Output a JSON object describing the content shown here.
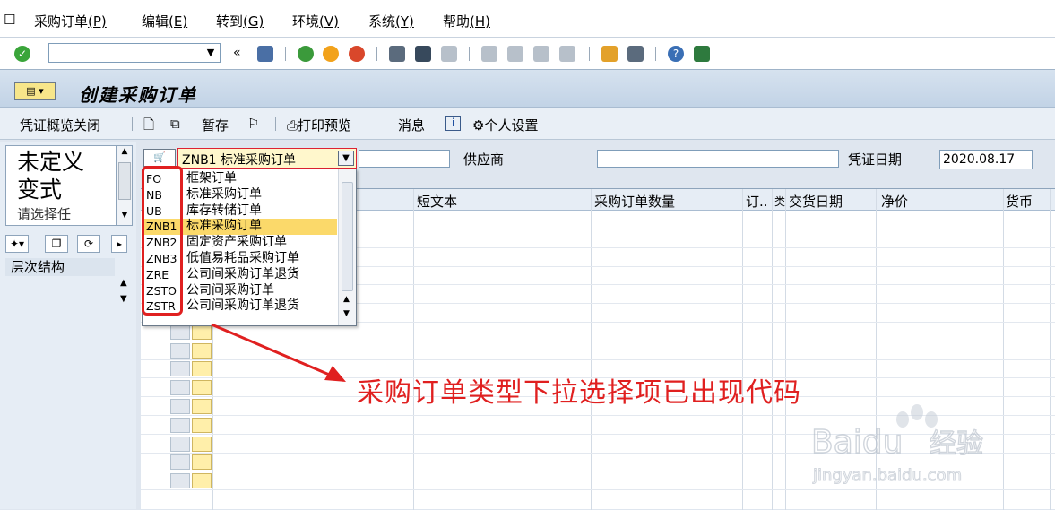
{
  "menu": {
    "items": [
      {
        "label": "采购订单",
        "key": "(P)"
      },
      {
        "label": "编辑",
        "key": "(E)"
      },
      {
        "label": "转到",
        "key": "(G)"
      },
      {
        "label": "环境",
        "key": "(V)"
      },
      {
        "label": "系统",
        "key": "(Y)"
      },
      {
        "label": "帮助",
        "key": "(H)"
      }
    ]
  },
  "toolbar": {
    "command_value": "",
    "back_symbol": "«"
  },
  "title": {
    "text": "创建采购订单"
  },
  "app_toolbar": {
    "doc_overview_close": "凭证概览关闭",
    "hold": "暂存",
    "print_preview": "打印预览",
    "messages": "消息",
    "personal_settings": "个人设置"
  },
  "left_panel": {
    "variant_line1": "未定义",
    "variant_line2": "变式",
    "variant_line3": "请选择任",
    "hierarchy_label": "层次结构"
  },
  "header": {
    "doc_type_value": "ZNB1 标准采购订单",
    "vendor_label": "供应商",
    "doc_date_label": "凭证日期",
    "doc_date_value": "2020.08.17"
  },
  "grid": {
    "columns": [
      "短文本",
      "采购订单数量",
      "订..",
      "类",
      "交货日期",
      "净价",
      "货币"
    ]
  },
  "dropdown": {
    "options": [
      {
        "code": "FO",
        "text": "框架订单"
      },
      {
        "code": "NB",
        "text": "标准采购订单"
      },
      {
        "code": "UB",
        "text": "库存转储订单"
      },
      {
        "code": "ZNB1",
        "text": "标准采购订单"
      },
      {
        "code": "ZNB2",
        "text": "固定资产采购订单"
      },
      {
        "code": "ZNB3",
        "text": "低值易耗品采购订单"
      },
      {
        "code": "ZRE",
        "text": "公司间采购订单退货"
      },
      {
        "code": "ZSTO",
        "text": "公司间采购订单"
      },
      {
        "code": "ZSTR",
        "text": "公司间采购订单退货"
      }
    ],
    "selected_index": 3
  },
  "annotation": {
    "text": "采购订单类型下拉选择项已出现代码",
    "color": "#e02020"
  },
  "watermark": {
    "brand": "Baidu",
    "suffix": "经验",
    "url": "jingyan.baidu.com"
  }
}
